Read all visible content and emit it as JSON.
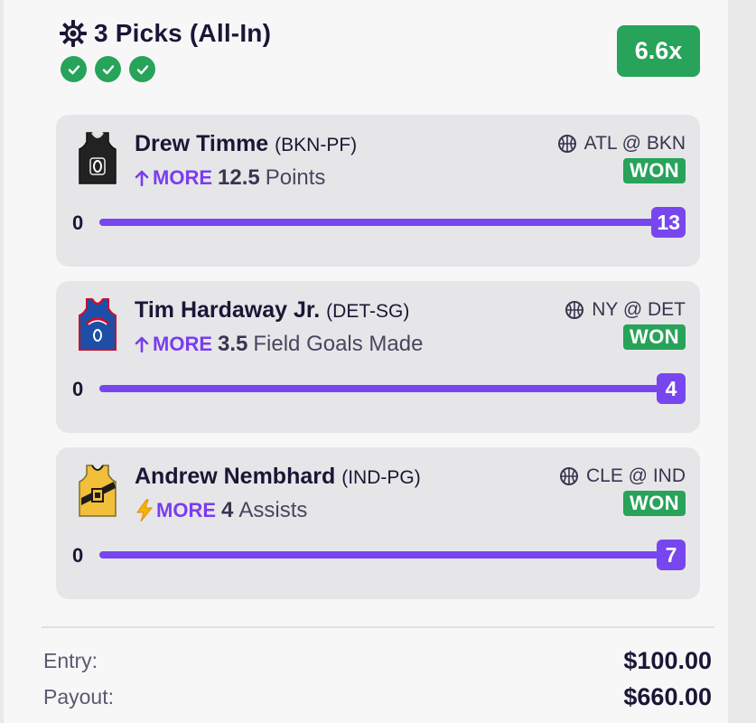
{
  "header": {
    "title": "3 Picks (All-In)",
    "multiplier": "6.6x",
    "checks": 3,
    "colors": {
      "accent": "#7746ef",
      "success": "#27a35a"
    }
  },
  "picks": [
    {
      "player": "Drew Timme",
      "position": "(BKN-PF)",
      "direction": "MORE",
      "direction_icon": "arrow-up-icon",
      "line_value": "12.5",
      "stat": "Points",
      "matchup": "ATL @ BKN",
      "result": "WON",
      "min_label": "0",
      "actual": "13",
      "progress": 1.0,
      "jersey_icon": "jersey-bkn-icon"
    },
    {
      "player": "Tim Hardaway Jr.",
      "position": "(DET-SG)",
      "direction": "MORE",
      "direction_icon": "arrow-up-icon",
      "line_value": "3.5",
      "stat": "Field Goals Made",
      "matchup": "NY @ DET",
      "result": "WON",
      "min_label": "0",
      "actual": "4",
      "progress": 1.0,
      "jersey_icon": "jersey-det-icon"
    },
    {
      "player": "Andrew Nembhard",
      "position": "(IND-PG)",
      "direction": "MORE",
      "direction_icon": "lightning-icon",
      "line_value": "4",
      "stat": "Assists",
      "matchup": "CLE @ IND",
      "result": "WON",
      "min_label": "0",
      "actual": "7",
      "progress": 1.0,
      "jersey_icon": "jersey-ind-icon"
    }
  ],
  "summary": {
    "entry_label": "Entry:",
    "entry_value": "$100.00",
    "payout_label": "Payout:",
    "payout_value": "$660.00"
  }
}
